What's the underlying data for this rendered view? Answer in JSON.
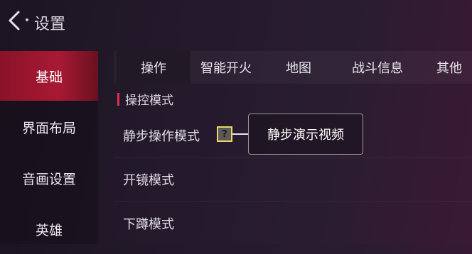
{
  "header": {
    "title": "设置"
  },
  "sidebar": {
    "items": [
      {
        "label": "基础"
      },
      {
        "label": "界面布局"
      },
      {
        "label": "音画设置"
      },
      {
        "label": "英雄"
      }
    ]
  },
  "tabs": [
    {
      "label": "操作"
    },
    {
      "label": "智能开火"
    },
    {
      "label": "地图"
    },
    {
      "label": "战斗信息"
    },
    {
      "label": "其他"
    }
  ],
  "section": {
    "title": "操控模式"
  },
  "rows": [
    {
      "label": "静步操作模式"
    },
    {
      "label": "开镜模式"
    },
    {
      "label": "下蹲模式"
    }
  ],
  "help": {
    "symbol": "?"
  },
  "tooltip": {
    "text": "静步演示视频"
  },
  "colors": {
    "accent": "#a81934",
    "marker": "#e0304a",
    "help_border": "#e8d86a"
  }
}
